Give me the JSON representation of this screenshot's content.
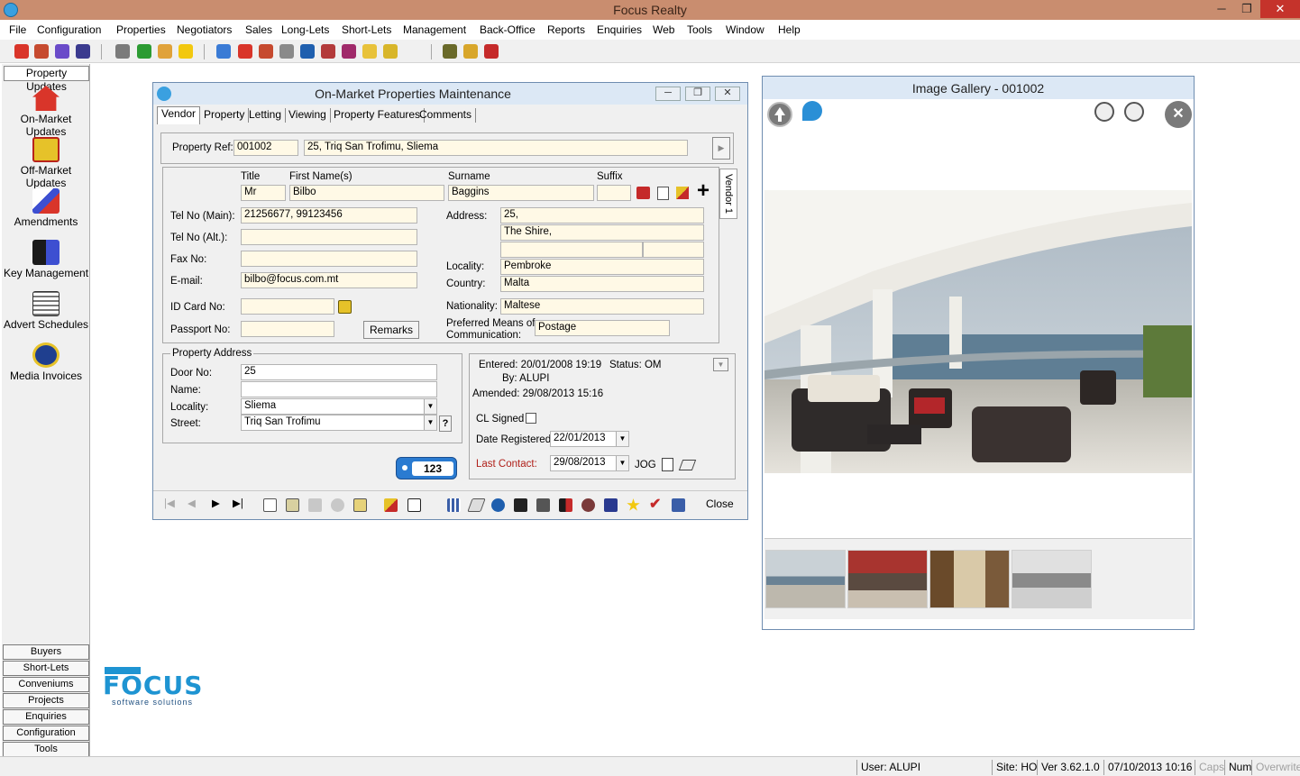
{
  "app": {
    "title": "Focus Realty"
  },
  "window_controls": {
    "minimize": "─",
    "restore": "❐",
    "close": "✕"
  },
  "menu": [
    "File",
    "Configuration",
    "Properties",
    "Negotiators",
    "Sales",
    "Long-Lets",
    "Short-Lets",
    "Management",
    "Back-Office",
    "Reports",
    "Enquiries",
    "Web",
    "Tools",
    "Window",
    "Help"
  ],
  "sidebar": {
    "header": "Property Updates",
    "items": [
      {
        "label": "On-Market Updates",
        "icon": "house-icon"
      },
      {
        "label": "Off-Market Updates",
        "icon": "sold-sign-icon"
      },
      {
        "label": "Amendments",
        "icon": "edit-document-icon"
      },
      {
        "label": "Key Management",
        "icon": "keys-icon"
      },
      {
        "label": "Advert Schedules",
        "icon": "newspaper-icon"
      },
      {
        "label": "Media Invoices",
        "icon": "invoice-badge-icon"
      }
    ],
    "bottom_buttons": [
      "Buyers",
      "Short-Lets",
      "Conveniums",
      "Projects",
      "Enquiries",
      "Configuration",
      "Tools"
    ]
  },
  "logo": {
    "text": "FOCUS",
    "tagline": "software solutions"
  },
  "maintenance": {
    "title": "On-Market Properties Maintenance",
    "tabs": [
      "Vendor",
      "Property",
      "Letting",
      "Viewing",
      "Property Features",
      "Comments"
    ],
    "property_ref_label": "Property Ref:",
    "property_ref": "001002",
    "property_address_line": "25, Triq San Trofimu, Sliema",
    "vendor_tab": "Vendor 1",
    "vendor": {
      "title_label": "Title",
      "title": "Mr",
      "first_name_label": "First Name(s)",
      "first_name": "Bilbo",
      "surname_label": "Surname",
      "surname": "Baggins",
      "suffix_label": "Suffix",
      "suffix": "",
      "tel_main_label": "Tel No (Main):",
      "tel_main": "21256677, 99123456",
      "tel_alt_label": "Tel No (Alt.):",
      "tel_alt": "",
      "fax_label": "Fax No:",
      "fax": "",
      "email_label": "E-mail:",
      "email": "bilbo@focus.com.mt",
      "id_card_label": "ID Card No:",
      "id_card": "",
      "passport_label": "Passport No:",
      "passport": "",
      "remarks_button": "Remarks",
      "address_label": "Address:",
      "address_line1": "25,",
      "address_line2": "The Shire,",
      "address_line3": "",
      "locality_label": "Locality:",
      "locality": "Pembroke",
      "country_label": "Country:",
      "country": "Malta",
      "nationality_label": "Nationality:",
      "nationality": "Maltese",
      "pref_comm_label_1": "Preferred Means of",
      "pref_comm_label_2": "Communication:",
      "pref_comm": "Postage"
    },
    "property_address": {
      "legend": "Property Address",
      "door_no_label": "Door No:",
      "door_no": "25",
      "name_label": "Name:",
      "name": "",
      "locality_label": "Locality:",
      "locality": "Sliema",
      "street_label": "Street:",
      "street": "Triq San Trofimu",
      "help": "?"
    },
    "counter_badge": "123",
    "info": {
      "entered": "Entered: 20/01/2008 19:19",
      "status": "Status:   OM",
      "by": "By:  ALUPI",
      "amended": "Amended: 29/08/2013 15:16",
      "cl_signed_label": "CL Signed",
      "cl_signed": false,
      "date_registered_label": "Date Registered:",
      "date_registered": "22/01/2013",
      "last_contact_label": "Last Contact:",
      "last_contact": "29/08/2013",
      "jog": "JOG"
    },
    "nav": {
      "first": "|◀",
      "prev": "◀",
      "next": "▶",
      "last": "▶|"
    },
    "close_button": "Close",
    "colors": {
      "last_contact": "#b0201a",
      "badge": "#2a7bd1"
    }
  },
  "gallery": {
    "title": "Image Gallery - 001002",
    "thumbnail_count": 4
  },
  "status": {
    "user": "User: ALUPI",
    "site": "Site: HO",
    "version": "Ver 3.62.1.0",
    "datetime": "07/10/2013 10:16",
    "caps": "Caps",
    "num": "Num",
    "overwrite": "Overwrite"
  }
}
